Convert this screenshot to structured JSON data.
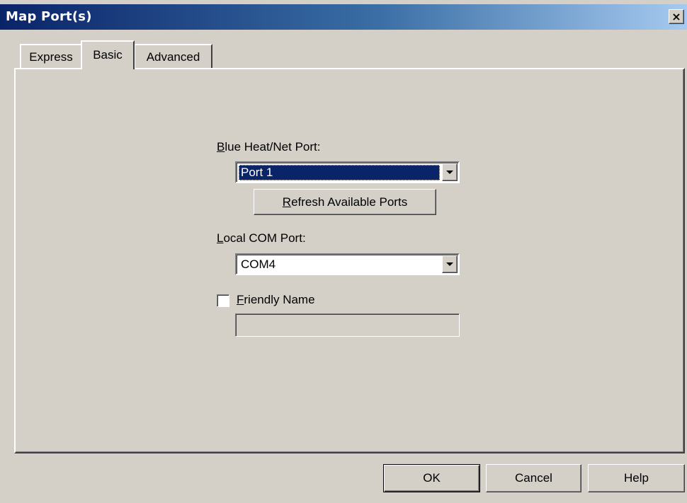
{
  "window": {
    "title": "Map Port(s)",
    "close_glyph": "×"
  },
  "tabs": [
    {
      "label": "Express",
      "active": false
    },
    {
      "label": "Basic",
      "active": true
    },
    {
      "label": "Advanced",
      "active": false
    }
  ],
  "form": {
    "blue_heat_port": {
      "label_hotkey": "B",
      "label_rest": "lue Heat/Net Port:",
      "value": "Port 1"
    },
    "refresh_button": {
      "label_hotkey": "R",
      "label_rest": "efresh Available Ports"
    },
    "local_com_port": {
      "label_hotkey": "L",
      "label_rest": "ocal COM Port:",
      "value": "COM4"
    },
    "friendly_name": {
      "label_hotkey": "F",
      "label_rest": "riendly Name",
      "checked": false,
      "value": ""
    }
  },
  "buttons": {
    "ok": "OK",
    "cancel": "Cancel",
    "help": "Help"
  },
  "colors": {
    "titlebar_start": "#0a246a",
    "face": "#d4d0c8",
    "selection": "#0a246a"
  }
}
